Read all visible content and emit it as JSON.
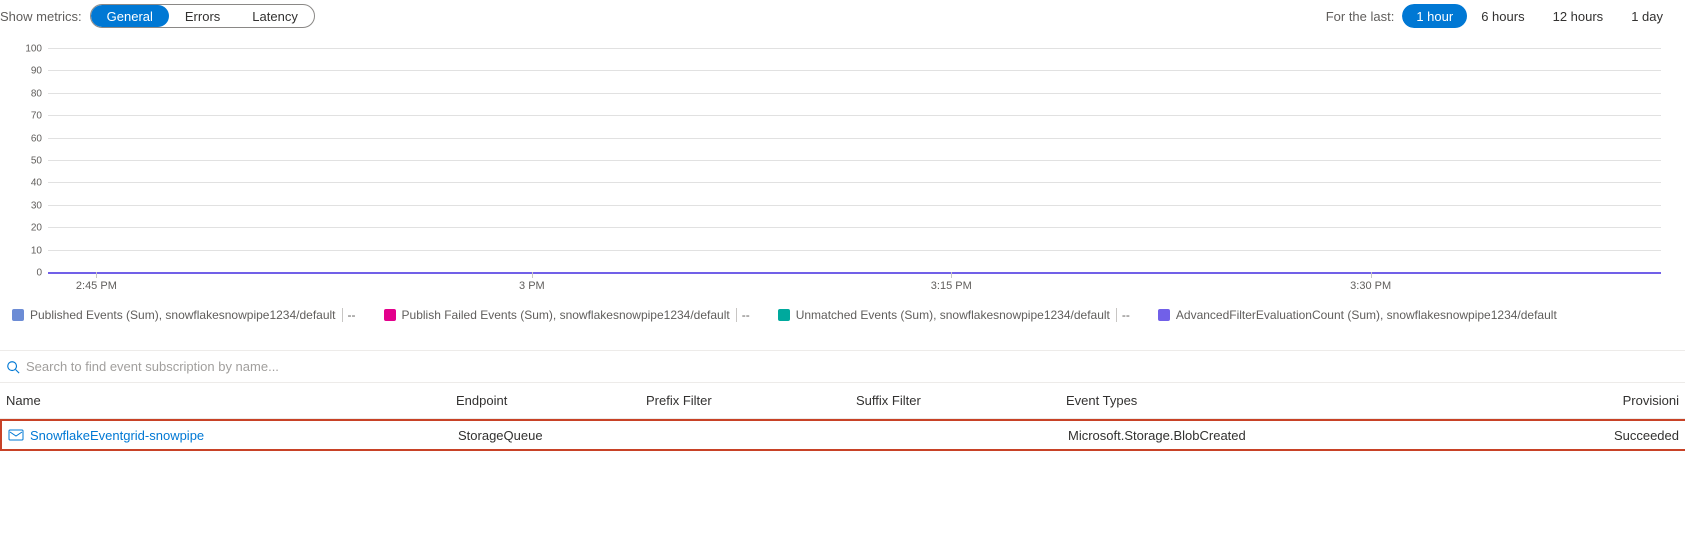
{
  "toolbar": {
    "metrics_label": "Show metrics:",
    "metrics_options": [
      "General",
      "Errors",
      "Latency"
    ],
    "metrics_active_index": 0,
    "time_label": "For the last:",
    "time_options": [
      "1 hour",
      "6 hours",
      "12 hours",
      "1 day"
    ],
    "time_active_index": 0
  },
  "chart_data": {
    "type": "line",
    "x_ticks": [
      "2:45 PM",
      "3 PM",
      "3:15 PM",
      "3:30 PM"
    ],
    "y_ticks": [
      0,
      10,
      20,
      30,
      40,
      50,
      60,
      70,
      80,
      90,
      100
    ],
    "ylim": [
      0,
      100
    ],
    "series": [
      {
        "name": "Published Events (Sum), snowflakesnowpipe1234/default",
        "color": "#6c8cd5",
        "value_text": "--",
        "values": []
      },
      {
        "name": "Publish Failed Events (Sum), snowflakesnowpipe1234/default",
        "color": "#e3008c",
        "value_text": "--",
        "values": []
      },
      {
        "name": "Unmatched Events (Sum), snowflakesnowpipe1234/default",
        "color": "#00a99d",
        "value_text": "--",
        "values": []
      },
      {
        "name": "AdvancedFilterEvaluationCount (Sum), snowflakesnowpipe1234/default",
        "color": "#7160e8",
        "value_text": "",
        "values": []
      }
    ]
  },
  "search": {
    "placeholder": "Search to find event subscription by name..."
  },
  "table": {
    "columns": [
      "Name",
      "Endpoint",
      "Prefix Filter",
      "Suffix Filter",
      "Event Types",
      "Provisioni"
    ],
    "rows": [
      {
        "name": "SnowflakeEventgrid-snowpipe",
        "endpoint": "StorageQueue",
        "prefix_filter": "",
        "suffix_filter": "",
        "event_types": "Microsoft.Storage.BlobCreated",
        "provisioning": "Succeeded"
      }
    ]
  }
}
